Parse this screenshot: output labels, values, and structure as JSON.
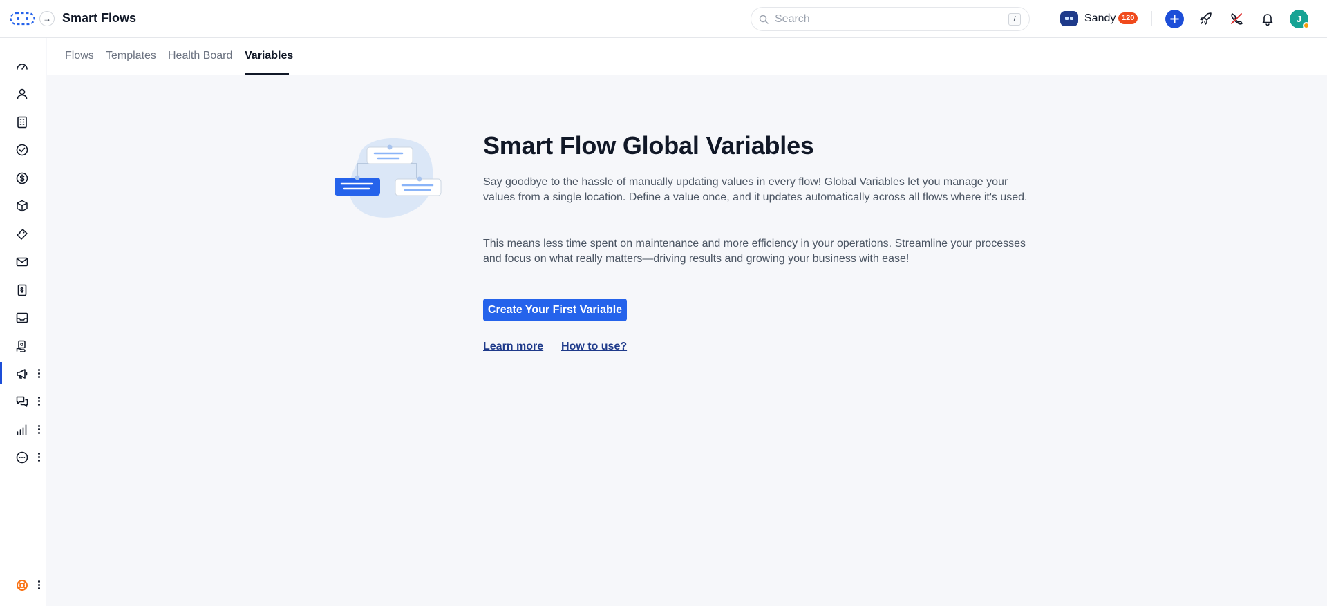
{
  "header": {
    "title": "Smart Flows",
    "search_placeholder": "Search",
    "search_shortcut": "/",
    "user_name": "Sandy",
    "user_badge": "120",
    "avatar_initial": "J"
  },
  "sidebar": {
    "items": [
      {
        "icon": "dashboard-gauge-icon"
      },
      {
        "icon": "user-icon"
      },
      {
        "icon": "building-icon"
      },
      {
        "icon": "check-circle-icon"
      },
      {
        "icon": "dollar-circle-icon"
      },
      {
        "icon": "box-icon"
      },
      {
        "icon": "ticket-icon"
      },
      {
        "icon": "mail-icon"
      },
      {
        "icon": "invoice-icon"
      },
      {
        "icon": "inbox-icon"
      },
      {
        "icon": "hand-coin-icon"
      },
      {
        "icon": "megaphone-icon",
        "active": true,
        "has_menu": true
      },
      {
        "icon": "chat-bubbles-icon",
        "has_menu": true
      },
      {
        "icon": "bar-chart-icon",
        "has_menu": true
      },
      {
        "icon": "more-circle-icon",
        "has_menu": true
      }
    ],
    "footer_icon": "lifebuoy-icon"
  },
  "tabs": [
    {
      "label": "Flows"
    },
    {
      "label": "Templates"
    },
    {
      "label": "Health Board"
    },
    {
      "label": "Variables",
      "active": true
    }
  ],
  "main": {
    "heading": "Smart Flow Global Variables",
    "paragraph_1": "Say goodbye to the hassle of manually updating values in every flow! Global Variables let you manage your values from a single location. Define a value once, and it updates automatically across all flows where it's used.",
    "paragraph_2": "This means less time spent on maintenance and more efficiency in your operations. Streamline your processes and focus on what really matters—driving results and growing your business with ease!",
    "cta_label": "Create Your First Variable",
    "learn_more_label": "Learn more ",
    "how_to_use_label": "How to use?"
  },
  "colors": {
    "accent": "#2563eb",
    "link": "#1e3a8a",
    "badge": "#f04a1c",
    "avatar": "#16a394",
    "background": "#f6f7fa"
  }
}
